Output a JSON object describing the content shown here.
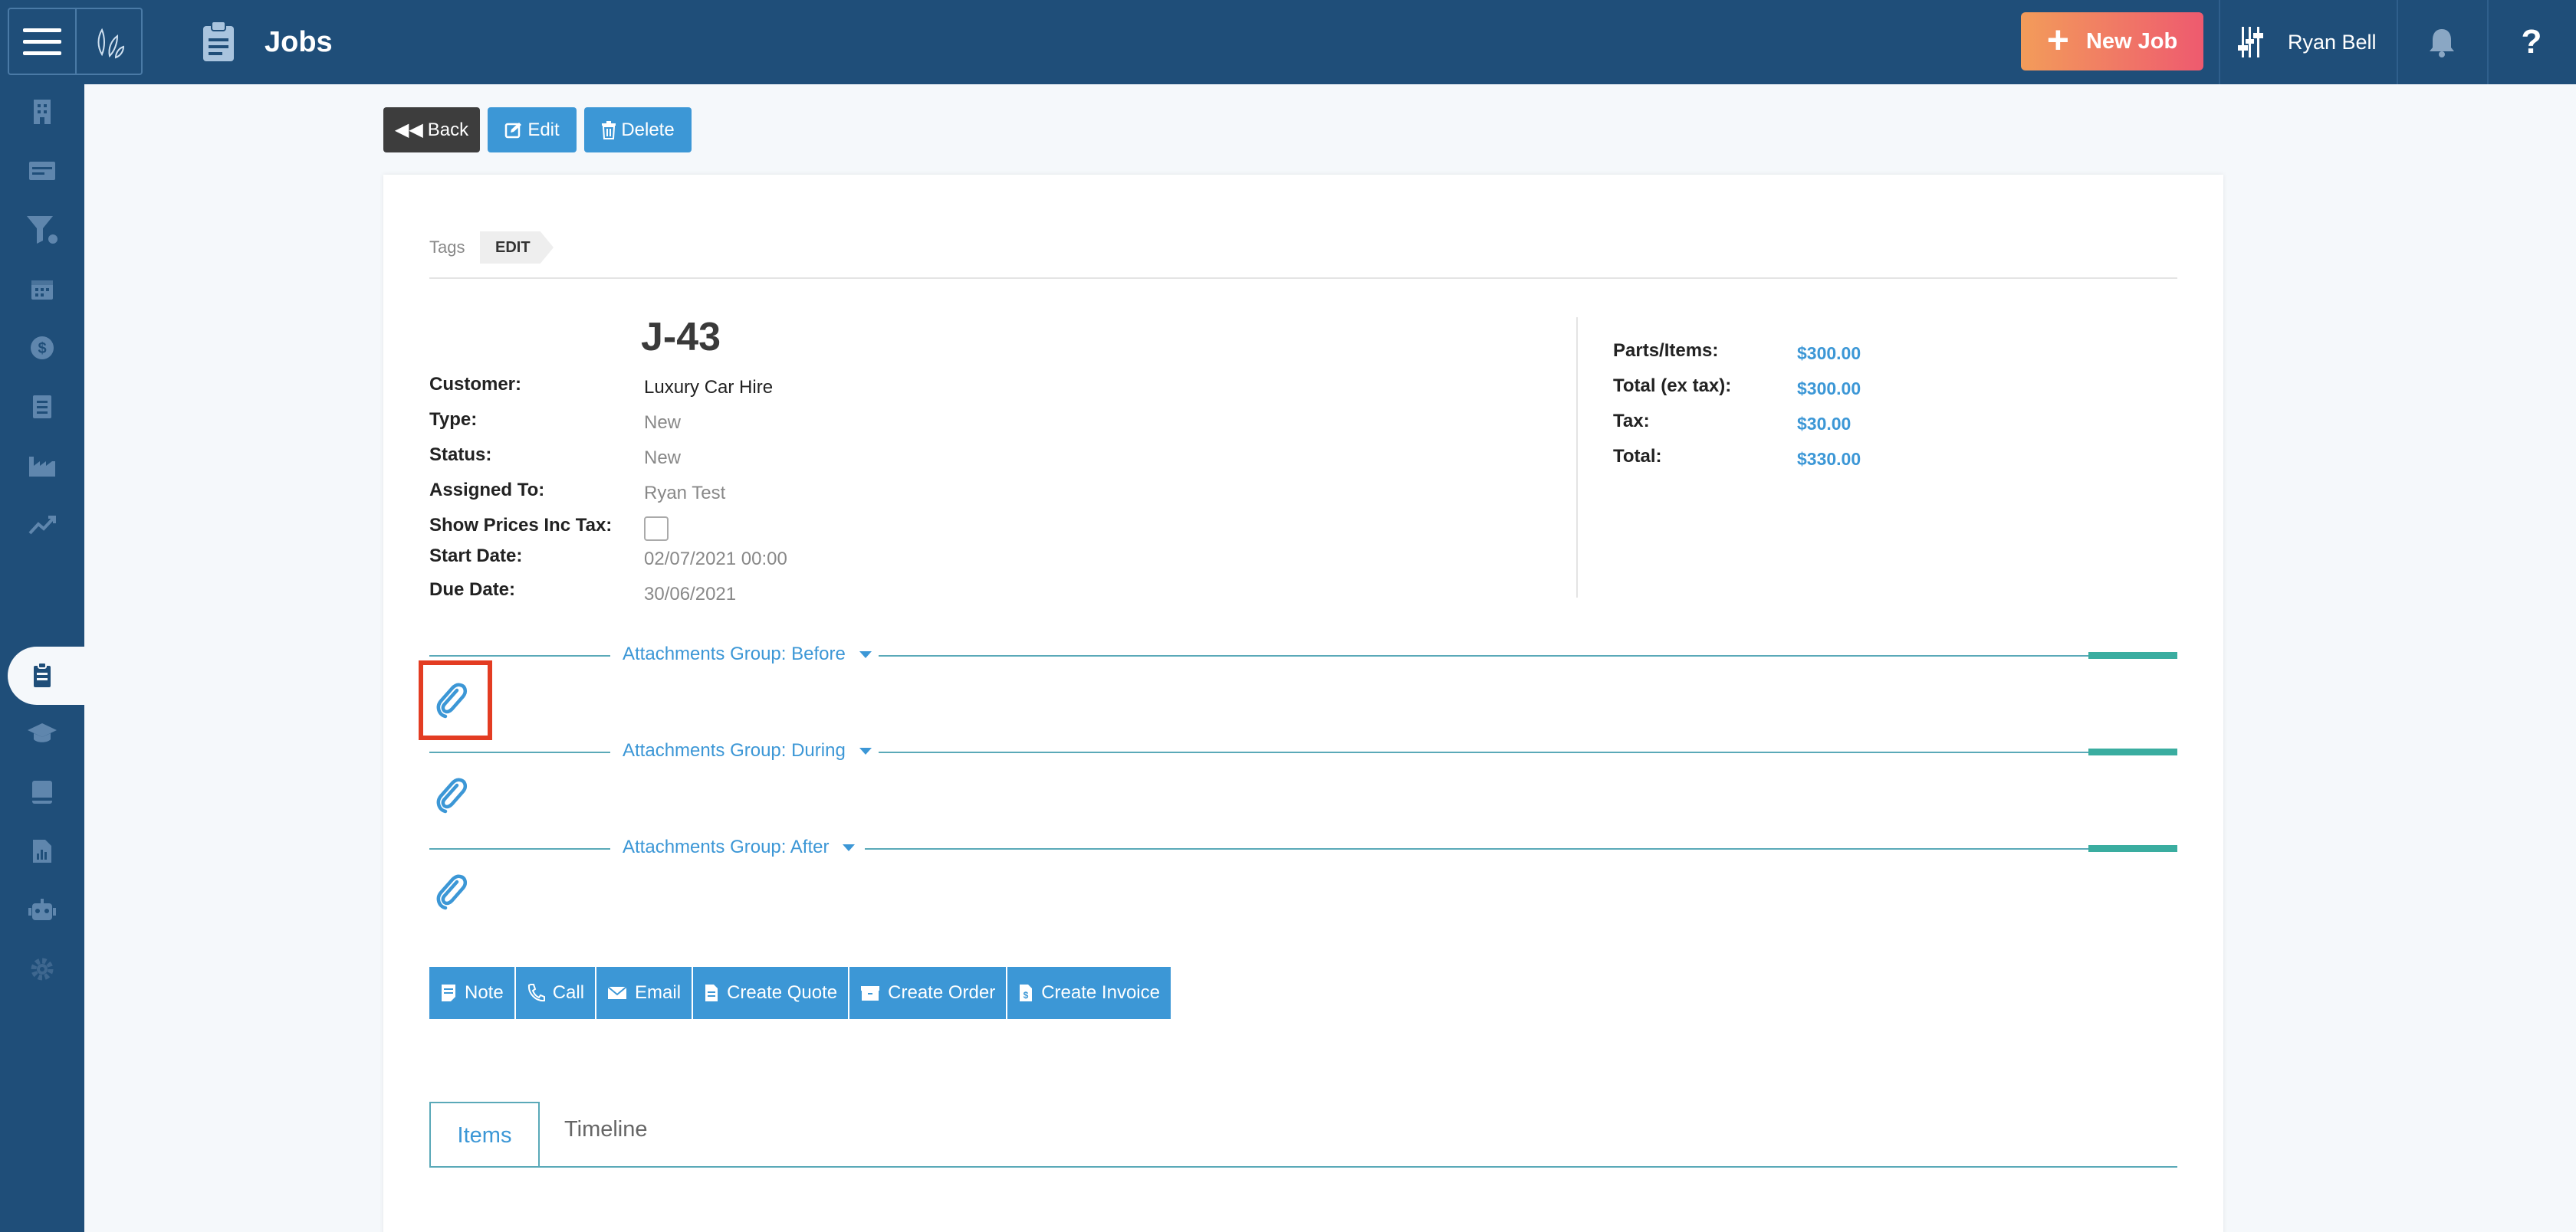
{
  "header": {
    "title": "Jobs",
    "new_job_label": "New Job",
    "user_name": "Ryan Bell",
    "help_label": "?"
  },
  "sidebar": {
    "items": [
      {
        "icon": "building-icon"
      },
      {
        "icon": "card-icon"
      },
      {
        "icon": "funnel-icon"
      },
      {
        "icon": "calendar-icon"
      },
      {
        "icon": "dollar-icon"
      },
      {
        "icon": "list-icon"
      },
      {
        "icon": "factory-icon"
      },
      {
        "icon": "trend-icon"
      },
      {
        "icon": "clipboard-icon",
        "active": true
      },
      {
        "icon": "graduation-icon"
      },
      {
        "icon": "book-icon"
      },
      {
        "icon": "report-icon"
      },
      {
        "icon": "robot-icon"
      },
      {
        "icon": "gear-icon"
      }
    ]
  },
  "toolbar": {
    "back_label": "Back",
    "edit_label": "Edit",
    "delete_label": "Delete"
  },
  "tags": {
    "label": "Tags",
    "edit_label": "EDIT"
  },
  "job": {
    "id": "J-43",
    "fields": {
      "customer_label": "Customer:",
      "customer_value": "Luxury Car Hire",
      "type_label": "Type:",
      "type_value": "New",
      "status_label": "Status:",
      "status_value": "New",
      "assigned_label": "Assigned To:",
      "assigned_value": "Ryan Test",
      "show_prices_label": "Show Prices Inc Tax:",
      "start_label": "Start Date:",
      "start_value": "02/07/2021 00:00",
      "due_label": "Due Date:",
      "due_value": "30/06/2021"
    }
  },
  "totals": {
    "parts_label": "Parts/Items:",
    "parts_value": "$300.00",
    "ex_tax_label": "Total (ex tax):",
    "ex_tax_value": "$300.00",
    "tax_label": "Tax:",
    "tax_value": "$30.00",
    "total_label": "Total:",
    "total_value": "$330.00"
  },
  "attachments": {
    "before": "Attachments Group: Before",
    "during": "Attachments Group: During",
    "after": "Attachments Group: After"
  },
  "actions": {
    "note": "Note",
    "call": "Call",
    "email": "Email",
    "create_quote": "Create Quote",
    "create_order": "Create Order",
    "create_invoice": "Create Invoice"
  },
  "tabs": {
    "items": "Items",
    "timeline": "Timeline"
  },
  "colors": {
    "primary": "#1f4e79",
    "accent": "#3c97d6",
    "highlight": "#e33c22"
  }
}
